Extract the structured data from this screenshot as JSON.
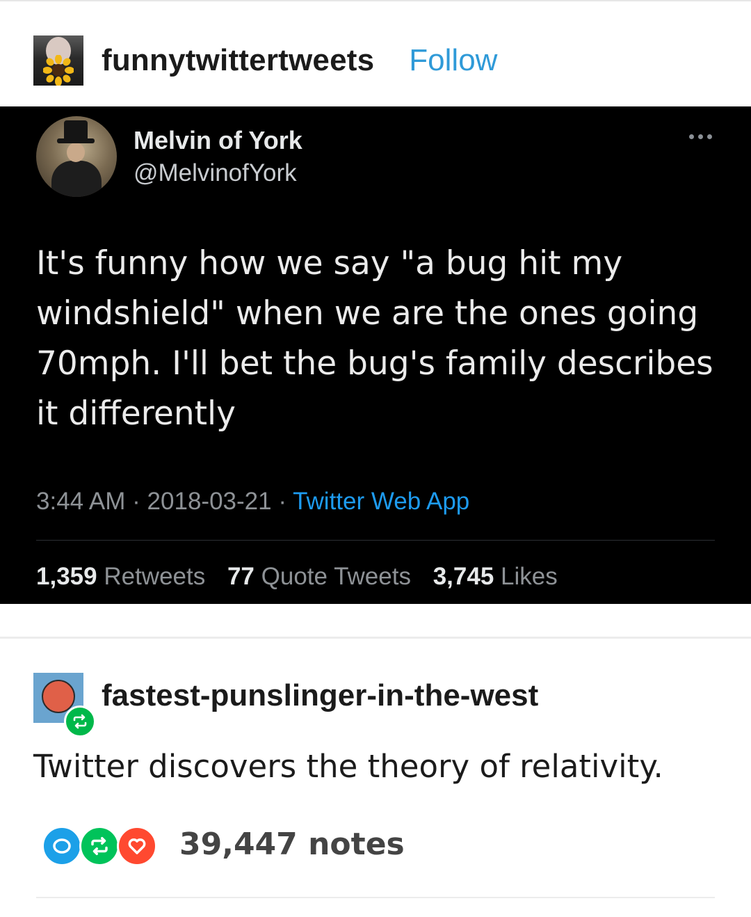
{
  "post": {
    "blog_name": "funnytwittertweets",
    "follow_label": "Follow"
  },
  "tweet": {
    "author_name": "Melvin of York",
    "author_handle": "@MelvinofYork",
    "text": "It's funny how we say \"a bug hit my windshield\" when we are the ones going 70mph. I'll bet the bug's family describes it differently",
    "time": "3:44 AM",
    "date": "2018-03-21",
    "source": "Twitter Web App",
    "stats": {
      "retweets_count": "1,359",
      "retweets_label": "Retweets",
      "quotes_count": "77",
      "quotes_label": "Quote Tweets",
      "likes_count": "3,745",
      "likes_label": "Likes"
    }
  },
  "reblog": {
    "blog_name": "fastest-punslinger-in-the-west",
    "text": "Twitter discovers the theory of relativity."
  },
  "notes": {
    "count_label": "39,447 notes"
  },
  "colors": {
    "follow": "#2f9ad8",
    "tweet_background": "#000000",
    "tweet_source": "#1d9bf0",
    "reblog_badge": "#00b84a",
    "notes_comment": "#1ca0e8",
    "notes_reblog": "#00c35a",
    "notes_like": "#ff4930"
  }
}
